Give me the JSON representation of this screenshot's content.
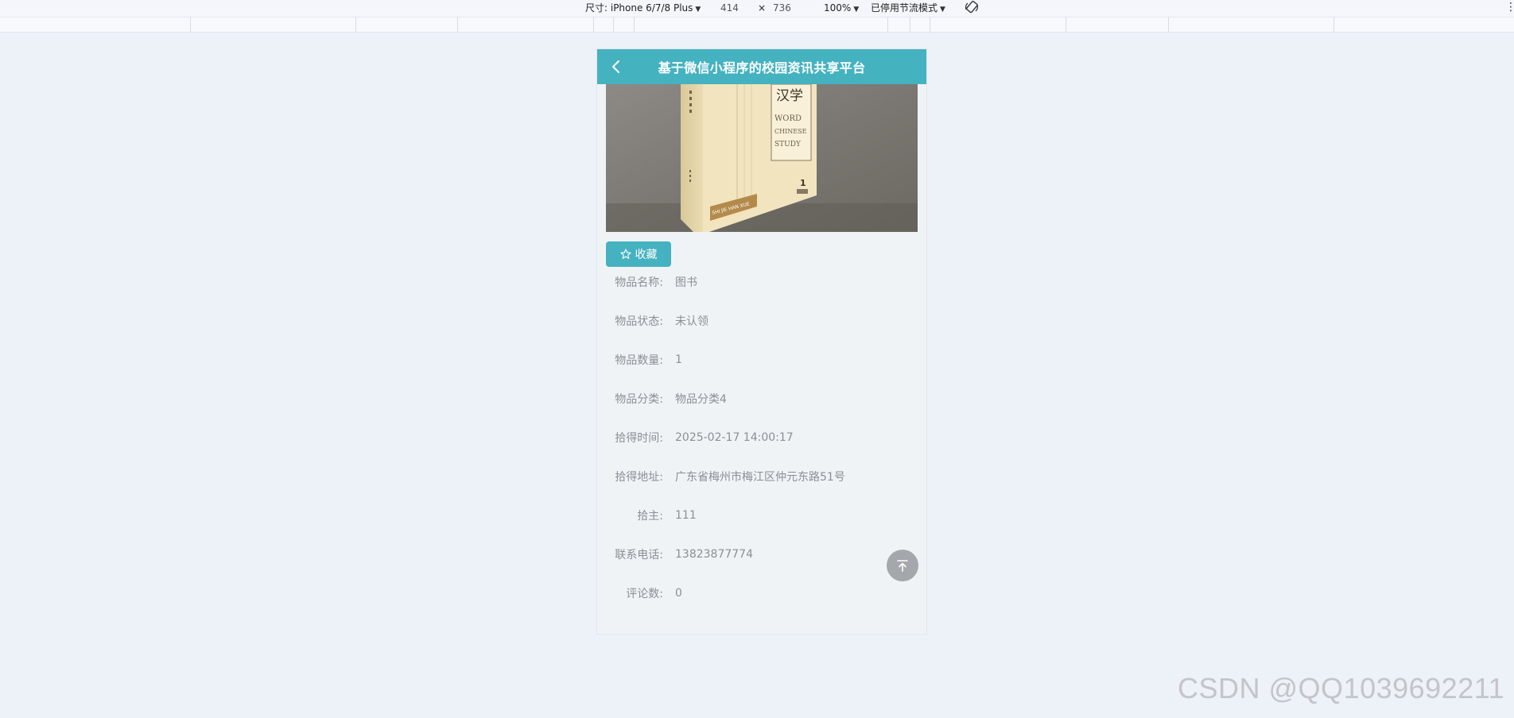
{
  "devtools": {
    "dimensions_label": "尺寸: iPhone 6/7/8 Plus",
    "width": "414",
    "times": "×",
    "height": "736",
    "zoom": "100%",
    "throttle": "已停用节流模式"
  },
  "app": {
    "title": "基于微信小程序的校园资讯共享平台",
    "cover_text": {
      "title_cn": "汉学",
      "line1": "WORD",
      "line2": "CHINESE",
      "line3": "STUDY",
      "issue": "1",
      "band": "SHI JIE HAN XUE"
    },
    "favorite_label": "收藏",
    "fields": [
      {
        "label": "物品名称:",
        "value": "图书"
      },
      {
        "label": "物品状态:",
        "value": "未认领"
      },
      {
        "label": "物品数量:",
        "value": "1"
      },
      {
        "label": "物品分类:",
        "value": "物品分类4"
      },
      {
        "label": "拾得时间:",
        "value": "2025-02-17 14:00:17"
      },
      {
        "label": "拾得地址:",
        "value": "广东省梅州市梅江区仲元东路51号"
      },
      {
        "label": "拾主:",
        "value": "111"
      },
      {
        "label": "联系电话:",
        "value": "13823877774"
      },
      {
        "label": "评论数:",
        "value": "0"
      }
    ]
  },
  "watermark": "CSDN @QQ1039692211",
  "colors": {
    "accent": "#45b2c0",
    "background": "#edf1f8",
    "text_muted": "#8a8f96"
  }
}
